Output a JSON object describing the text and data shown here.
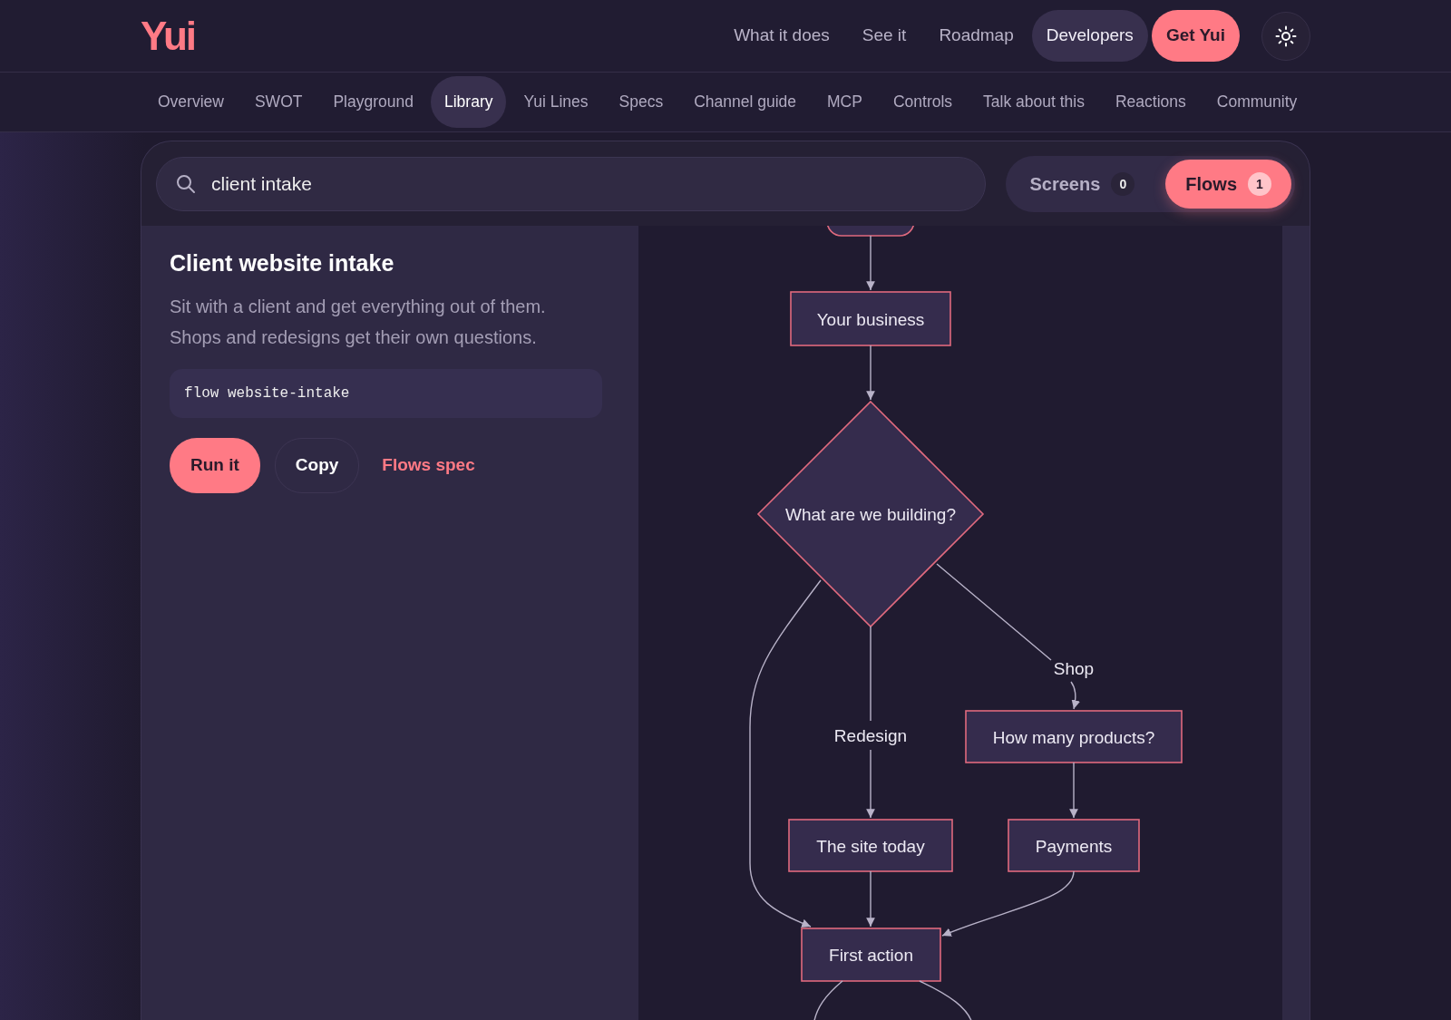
{
  "brand": "Yui",
  "top_nav": [
    {
      "label": "What it does",
      "kind": "link"
    },
    {
      "label": "See it",
      "kind": "link"
    },
    {
      "label": "Roadmap",
      "kind": "link"
    },
    {
      "label": "Developers",
      "kind": "pill"
    },
    {
      "label": "Get Yui",
      "kind": "primary"
    }
  ],
  "sub_nav": [
    {
      "label": "Overview",
      "selected": false
    },
    {
      "label": "SWOT",
      "selected": false
    },
    {
      "label": "Playground",
      "selected": false
    },
    {
      "label": "Library",
      "selected": true
    },
    {
      "label": "Yui Lines",
      "selected": false
    },
    {
      "label": "Specs",
      "selected": false
    },
    {
      "label": "Channel guide",
      "selected": false
    },
    {
      "label": "MCP",
      "selected": false
    },
    {
      "label": "Controls",
      "selected": false
    },
    {
      "label": "Talk about this",
      "selected": false
    },
    {
      "label": "Reactions",
      "selected": false
    },
    {
      "label": "Community",
      "selected": false
    }
  ],
  "search": {
    "value": "client intake"
  },
  "filter_tabs": [
    {
      "label": "Screens",
      "count": "0",
      "selected": false
    },
    {
      "label": "Flows",
      "count": "1",
      "selected": true
    }
  ],
  "flow": {
    "title": "Client website intake",
    "description": "Sit with a client and get everything out of them. Shops and redesigns get their own questions.",
    "command": "flow website-intake",
    "actions": [
      {
        "label": "Run it",
        "kind": "primary"
      },
      {
        "label": "Copy",
        "kind": "outline"
      },
      {
        "label": "Flows spec",
        "kind": "link"
      }
    ]
  },
  "diagram": {
    "nodes": [
      {
        "kind": "start"
      },
      {
        "kind": "process",
        "label": "Your business"
      },
      {
        "kind": "decision",
        "label": "What are we building?"
      },
      {
        "kind": "process",
        "label": "How many products?"
      },
      {
        "kind": "process",
        "label": "The site today"
      },
      {
        "kind": "process",
        "label": "Payments"
      },
      {
        "kind": "process",
        "label": "First action"
      }
    ],
    "edge_labels": [
      "Redesign",
      "Shop"
    ]
  }
}
